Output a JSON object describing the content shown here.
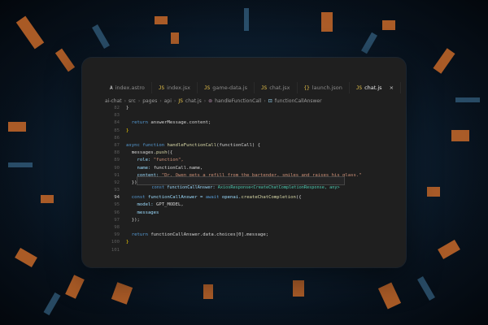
{
  "tabs": [
    {
      "label": "index.astro",
      "icon": "A",
      "active": false
    },
    {
      "label": "index.jsx",
      "icon": "JS",
      "active": false
    },
    {
      "label": "game-data.js",
      "icon": "JS",
      "active": false
    },
    {
      "label": "chat.jsx",
      "icon": "JS",
      "active": false
    },
    {
      "label": "launch.json",
      "icon": "{}",
      "active": false
    },
    {
      "label": "chat.js",
      "icon": "JS",
      "active": true
    }
  ],
  "breadcrumb": [
    "ai-chat",
    "src",
    "pages",
    "api",
    "chat.js",
    "handleFunctionCall",
    "functionCallAnswer"
  ],
  "line_numbers": [
    "82",
    "83",
    "84",
    "85",
    "86",
    "87",
    "88",
    "89",
    "90",
    "91",
    "92",
    "93",
    "94",
    "95",
    "96",
    "97",
    "98",
    "99",
    "100",
    "101"
  ],
  "code": {
    "l82": "}",
    "l84_kw": "return ",
    "l84_tx": "answerMessage.content;",
    "l85": "}",
    "l87_kw": "async function ",
    "l87_fn": "handleFunctionCall",
    "l87_tx": "(functionCall) {",
    "l88_tx": "  messages.",
    "l88_fn": "push",
    "l88_tx2": "({",
    "l89_prop": "    role: ",
    "l89_str": "\"function\",",
    "l90_prop": "    name: ",
    "l90_tx": "functionCall.name,",
    "l91_prop": "    content: ",
    "l91_str": "\"Dr. Owen gets a refill from the bartender, smiles and raises his glass.\"",
    "l92": "  });",
    "l94_kw": "  const ",
    "l94_tx": "functionCallAnswer = ",
    "l94_kw2": "await ",
    "l94_tx2": "openai.",
    "l94_fn": "createChatCompletion",
    "l94_tx3": "({",
    "l95_prop": "    model: ",
    "l95_tx": "GPT_MODEL,",
    "l96_tx": "    messages",
    "l97": "  });",
    "l99_kw": "  return ",
    "l99_tx": "functionCallAnswer.data.choices[0].message;",
    "l100": "}"
  },
  "tooltip": {
    "kw": "const ",
    "name": "functionCallAnswer: ",
    "type": "AxiosResponse<CreateChatCompletionResponse, any>"
  },
  "current_line": "94",
  "colors": {
    "editor_bg": "#1f1f1f",
    "keyword": "#569cd6",
    "function": "#dcdcaa",
    "string": "#ce9178",
    "property": "#9cdcfe",
    "type": "#4ec9b0"
  }
}
